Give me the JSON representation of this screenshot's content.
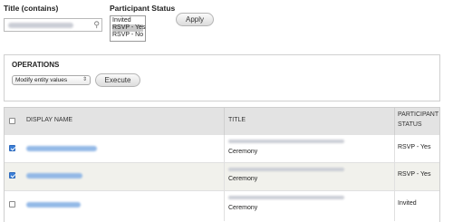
{
  "filters": {
    "title_label": "Title (contains)",
    "status_label": "Participant Status",
    "status_options": [
      "Invited",
      "RSVP - Yes",
      "RSVP - No"
    ],
    "selected_status": "RSVP - Yes",
    "apply_label": "Apply"
  },
  "operations": {
    "heading": "OPERATIONS",
    "select_value": "Modify entity values",
    "execute_label": "Execute"
  },
  "table": {
    "columns": [
      "DISPLAY NAME",
      "TITLE",
      "PARTICIPANT",
      "STATUS"
    ],
    "rows": [
      {
        "checked": true,
        "title_line2": "Ceremony",
        "status": "RSVP - Yes"
      },
      {
        "checked": true,
        "title_line2": "Ceremony",
        "status": "RSVP - Yes"
      },
      {
        "checked": false,
        "title_line2": "Ceremony",
        "status": "Invited"
      }
    ]
  },
  "colors": {
    "header_bg": "#e3e3e3",
    "row_alt_bg": "#f1f1ec",
    "link_blur": "#8fb6e6",
    "checkbox_checked": "#3d7fd6"
  }
}
